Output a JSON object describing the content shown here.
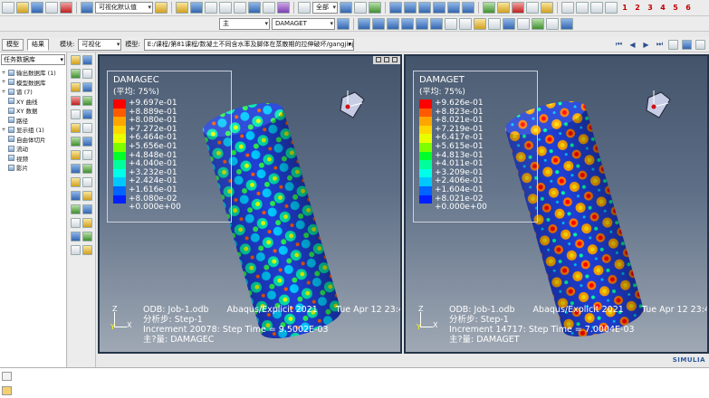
{
  "toolbar": {
    "module_combo": "可视化默认值",
    "part_combo": "全部",
    "field_combo_top": "主",
    "field_combo": "DAMAGET",
    "frame_numbers": [
      "1",
      "2",
      "3",
      "4",
      "5",
      "6"
    ]
  },
  "context": {
    "tabs": [
      "模型",
      "结果"
    ],
    "module_label": "模块:",
    "module_value": "可视化",
    "model_label": "模型:",
    "model_path": "E:/课程/第81课程/数凝土不同含水率及脚体在蒸散期的拉伸破坏/gangjinjinNT/Job-1.odb"
  },
  "tree": {
    "selector": "任务数据库",
    "items": [
      {
        "label": "输出数据库 (1)",
        "exp": "+"
      },
      {
        "label": "模型数据库",
        "exp": "+"
      },
      {
        "label": "谱 (7)",
        "exp": "+"
      },
      {
        "label": "XY 曲线",
        "exp": ""
      },
      {
        "label": "XY 数据",
        "exp": ""
      },
      {
        "label": "路径",
        "exp": ""
      },
      {
        "label": "显示组 (1)",
        "exp": "+"
      },
      {
        "label": "自由体切片",
        "exp": ""
      },
      {
        "label": "流动",
        "exp": ""
      },
      {
        "label": "视频",
        "exp": ""
      },
      {
        "label": "影片",
        "exp": ""
      }
    ]
  },
  "legend_colors": [
    "#ff0000",
    "#ff5a00",
    "#ffa500",
    "#ffd700",
    "#e8ff00",
    "#7dff00",
    "#00ff2a",
    "#00ff9c",
    "#00ffe8",
    "#00c8ff",
    "#0064ff",
    "#0020ff"
  ],
  "viewports": [
    {
      "legend": {
        "title": "DAMAGEC",
        "subtitle": "(平均: 75%)",
        "values": [
          "+9.697e-01",
          "+8.889e-01",
          "+8.080e-01",
          "+7.272e-01",
          "+6.464e-01",
          "+5.656e-01",
          "+4.848e-01",
          "+4.040e-01",
          "+3.232e-01",
          "+2.424e-01",
          "+1.616e-01",
          "+8.080e-02",
          "+0.000e+00"
        ]
      },
      "info": {
        "odb": "ODB: Job-1.odb",
        "solver": "Abaqus/Explicit 2021",
        "date": "Tue Apr 12 23:45",
        "step": "分析步: Step-1",
        "increment": "Increment      20078: Step Time =      9.5002E-03",
        "var": "主?量: DAMAGEC"
      }
    },
    {
      "legend": {
        "title": "DAMAGET",
        "subtitle": "(平均: 75%)",
        "values": [
          "+9.626e-01",
          "+8.823e-01",
          "+8.021e-01",
          "+7.219e-01",
          "+6.417e-01",
          "+5.615e-01",
          "+4.813e-01",
          "+4.011e-01",
          "+3.209e-01",
          "+2.406e-01",
          "+1.604e-01",
          "+8.021e-02",
          "+0.000e+00"
        ]
      },
      "info": {
        "odb": "ODB: Job-1.odb",
        "solver": "Abaqus/Explicit 2021",
        "date": "Tue Apr 12 23:45",
        "step": "分析步: Step-1",
        "increment": "Increment      14717: Step Time =      7.0004E-03",
        "var": "主?量: DAMAGET"
      }
    }
  ],
  "brand": "SIMULIA"
}
